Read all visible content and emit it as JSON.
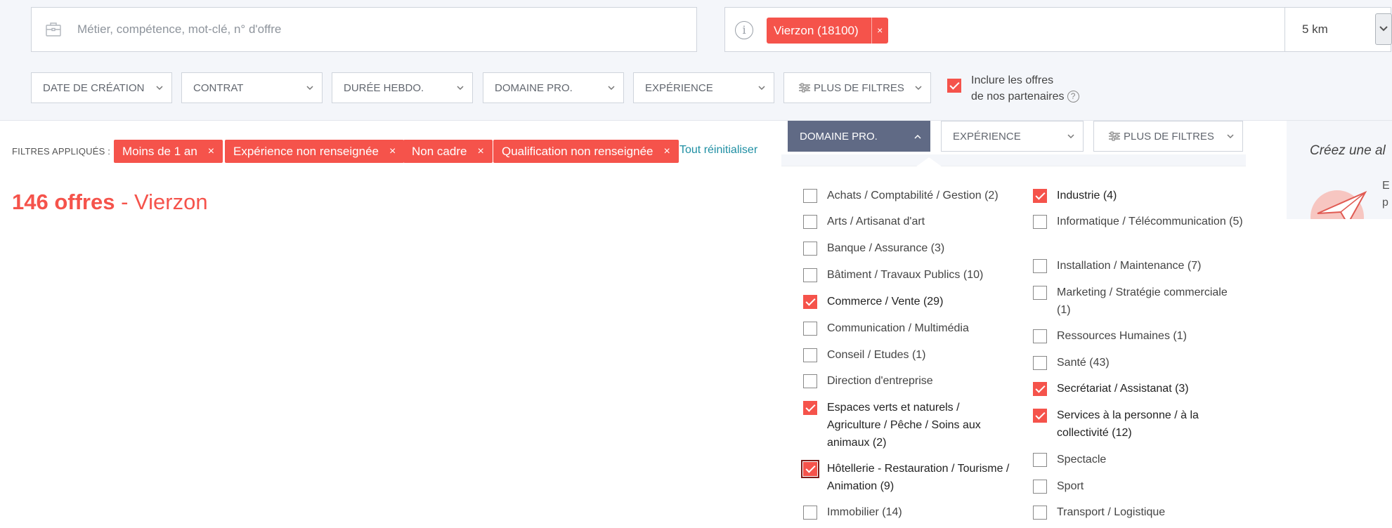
{
  "search": {
    "placeholder": "Métier, compétence, mot-clé, n° d'offre",
    "location_chip": "Vierzon (18100)",
    "location_remove": "×",
    "info_glyph": "i",
    "radius": "5 km"
  },
  "filters": {
    "top": [
      {
        "label": "DATE DE CRÉATION"
      },
      {
        "label": "CONTRAT"
      },
      {
        "label": "DURÉE HEBDO."
      },
      {
        "label": "DOMAINE PRO."
      },
      {
        "label": "EXPÉRIENCE"
      },
      {
        "label": "PLUS DE FILTRES"
      }
    ],
    "partners_line1": "Inclure les offres",
    "partners_line2": "de nos partenaires",
    "help_glyph": "?",
    "partners_checked": true
  },
  "applied": {
    "label": "FILTRES APPLIQUÉS :",
    "chips": [
      "Moins de 1 an",
      "Expérience non renseignée",
      "Non cadre",
      "Qualification non renseignée"
    ],
    "remove_glyph": "×",
    "reset": "Tout réinitialiser"
  },
  "results": {
    "count": "146 offres",
    "separator": " - ",
    "city": "Vierzon"
  },
  "secondary_filters": {
    "domaine": "DOMAINE PRO.",
    "experience": "EXPÉRIENCE",
    "plus": "PLUS DE FILTRES"
  },
  "domain_options": {
    "left": [
      {
        "label": "Achats / Comptabilité / Gestion (2)",
        "checked": false
      },
      {
        "label": "Arts / Artisanat d'art",
        "checked": false
      },
      {
        "label": "Banque / Assurance (3)",
        "checked": false
      },
      {
        "label": "Bâtiment / Travaux Publics (10)",
        "checked": false
      },
      {
        "label": "Commerce / Vente (29)",
        "checked": true
      },
      {
        "label": "Communication / Multimédia",
        "checked": false
      },
      {
        "label": "Conseil / Etudes (1)",
        "checked": false
      },
      {
        "label": "Direction d'entreprise",
        "checked": false
      },
      {
        "label": "Espaces verts et naturels / Agriculture / Pêche / Soins aux animaux (2)",
        "checked": true
      },
      {
        "label": "Hôtellerie - Restauration / Tourisme / Animation (9)",
        "checked": true
      },
      {
        "label": "Immobilier (14)",
        "checked": false
      }
    ],
    "right": [
      {
        "label": "Industrie (4)",
        "checked": true
      },
      {
        "label": "Informatique / Télécommunication (5)",
        "checked": false
      },
      {
        "label": "Installation / Maintenance (7)",
        "checked": false
      },
      {
        "label": "Marketing / Stratégie commerciale (1)",
        "checked": false
      },
      {
        "label": "Ressources Humaines (1)",
        "checked": false
      },
      {
        "label": "Santé (43)",
        "checked": false
      },
      {
        "label": "Secrétariat / Assistanat (3)",
        "checked": true
      },
      {
        "label": "Services à la personne / à la collectivité (12)",
        "checked": true
      },
      {
        "label": "Spectacle",
        "checked": false
      },
      {
        "label": "Sport",
        "checked": false
      },
      {
        "label": "Transport / Logistique",
        "checked": false
      }
    ]
  },
  "alert_panel": {
    "title": "Créez une al",
    "line1": "E",
    "line2": "p"
  },
  "colors": {
    "accent": "#f5534b",
    "link": "#1f8fa3",
    "active_dropdown": "#606a85"
  }
}
